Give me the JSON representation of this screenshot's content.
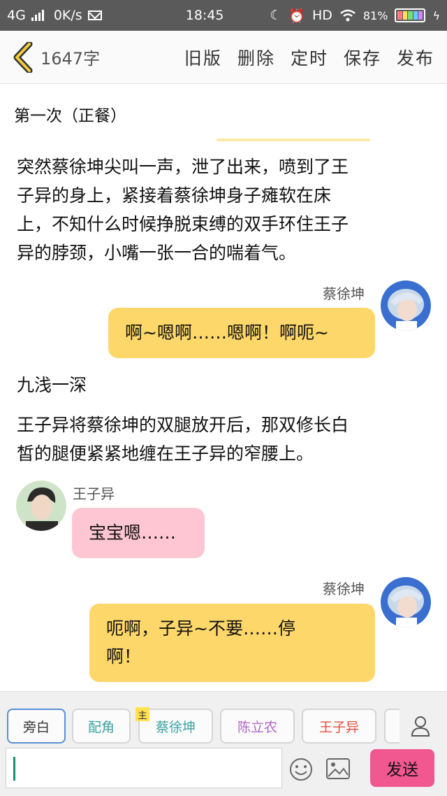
{
  "status_bar": {
    "network": "4G",
    "speed": "0K/s",
    "time": "18:45",
    "hd": "HD",
    "battery": "81%"
  },
  "toolbar": {
    "word_count": "1647字",
    "actions": [
      "旧版",
      "删除",
      "定时",
      "保存",
      "发布"
    ]
  },
  "content": {
    "chapter_title": "第一次（正餐）",
    "narration_1": [
      "突然蔡徐坤尖叫一声，泄了出来，喷到了王",
      "子异的身上，紧接着蔡徐坤身子瘫软在床",
      "上，不知什么时候挣脱束缚的双手环住王子",
      "异的脖颈，小嘴一张一合的喘着气。"
    ],
    "speaker_1": "蔡徐坤",
    "bubble_1": "啊~嗯啊……嗯啊！啊呃~",
    "narration_2": "九浅一深",
    "narration_3": [
      "王子异将蔡徐坤的双腿放开后，那双修长白",
      "皙的腿便紧紧地缠在王子异的窄腰上。"
    ],
    "speaker_2": "王子异",
    "bubble_2": "宝宝嗯……",
    "speaker_3": "蔡徐坤",
    "bubble_3_lines": [
      "呃啊，子异~不要……停",
      "啊！"
    ]
  },
  "bottom_bar": {
    "roles": [
      "旁白",
      "配角",
      "蔡徐坤",
      "陈立农",
      "王子异"
    ],
    "main_mark": "主",
    "input_value": "",
    "send_label": "发送"
  }
}
